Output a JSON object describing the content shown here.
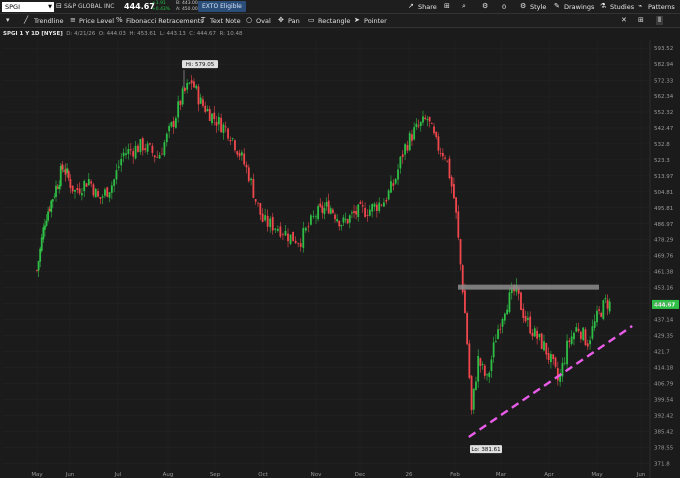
{
  "header": {
    "symbol": "SPGI",
    "company": "S&P GLOBAL INC",
    "last_price": "444.67",
    "change_line1": "+1.91",
    "change_line2": "+0.43%",
    "bid_line1": "B: 443.00",
    "bid_line2": "A: 450.00",
    "badge": "EXTO Eligible",
    "share_label": "Share",
    "count_label": "0",
    "style_label": "Style",
    "drawings_label": "Drawings",
    "studies_label": "Studies",
    "patterns_label": "Patterns"
  },
  "drawing_tools": {
    "trendline": "Trendline",
    "price_level": "Price Level",
    "fibonacci": "Fibonacci Retracements",
    "text_note": "Text Note",
    "oval": "Oval",
    "pan": "Pan",
    "rectangle": "Rectangle",
    "pointer": "Pointer"
  },
  "legend": {
    "title": "SPGI 1 Y 1D [NYSE]",
    "date": "D: 4/21/26",
    "open": "O: 444.03",
    "high": "H: 453.61",
    "low": "L: 443.13",
    "close": "C: 444.67",
    "volume": "R: 10.48"
  },
  "chart_data": {
    "type": "candlestick",
    "x_labels": [
      "May",
      "Jun",
      "Jul",
      "Aug",
      "Sep",
      "Oct",
      "Nov",
      "Dec",
      "26",
      "Feb",
      "Mar",
      "Apr",
      "May",
      "Jun"
    ],
    "y_ticks": [
      "593.52",
      "582.94",
      "572.33",
      "562.34",
      "552.32",
      "542.47",
      "532.8",
      "523.3",
      "513.97",
      "504.81",
      "495.81",
      "486.97",
      "478.29",
      "469.76",
      "461.38",
      "453.16",
      "445.0",
      "437.14",
      "429.35",
      "421.7",
      "414.18",
      "406.79",
      "399.54",
      "392.42",
      "385.42",
      "378.55",
      "371.8"
    ],
    "ylim": [
      369.0,
      599.0
    ],
    "y_scale": "log",
    "last_price": 444.67,
    "last_price_label": "444.67",
    "high_label": "Hi: 579.05",
    "low_label": "Lo: 381.61",
    "high_value": 579.05,
    "low_value": 381.61,
    "resistance_level": 453.16,
    "support_trendline": [
      {
        "month_index": 9.3,
        "price": 383
      },
      {
        "month_index": 12.8,
        "price": 434
      }
    ],
    "close_path": [
      {
        "m": 0.0,
        "v": 462
      },
      {
        "m": 0.25,
        "v": 490
      },
      {
        "m": 0.5,
        "v": 503
      },
      {
        "m": 0.8,
        "v": 520
      },
      {
        "m": 1.1,
        "v": 505
      },
      {
        "m": 1.4,
        "v": 512
      },
      {
        "m": 1.6,
        "v": 500
      },
      {
        "m": 1.9,
        "v": 510
      },
      {
        "m": 2.1,
        "v": 527
      },
      {
        "m": 2.5,
        "v": 532
      },
      {
        "m": 2.8,
        "v": 525
      },
      {
        "m": 3.1,
        "v": 545
      },
      {
        "m": 3.3,
        "v": 562
      },
      {
        "m": 3.5,
        "v": 572
      },
      {
        "m": 3.7,
        "v": 558
      },
      {
        "m": 4.0,
        "v": 548
      },
      {
        "m": 4.3,
        "v": 540
      },
      {
        "m": 4.5,
        "v": 528
      },
      {
        "m": 4.7,
        "v": 515
      },
      {
        "m": 4.85,
        "v": 500
      },
      {
        "m": 5.0,
        "v": 488
      },
      {
        "m": 5.3,
        "v": 485
      },
      {
        "m": 5.5,
        "v": 480
      },
      {
        "m": 5.7,
        "v": 478
      },
      {
        "m": 6.0,
        "v": 492
      },
      {
        "m": 6.3,
        "v": 497
      },
      {
        "m": 6.6,
        "v": 487
      },
      {
        "m": 6.9,
        "v": 493
      },
      {
        "m": 7.2,
        "v": 495
      },
      {
        "m": 7.5,
        "v": 500
      },
      {
        "m": 7.7,
        "v": 510
      },
      {
        "m": 7.9,
        "v": 530
      },
      {
        "m": 8.1,
        "v": 540
      },
      {
        "m": 8.4,
        "v": 548
      },
      {
        "m": 8.6,
        "v": 532
      },
      {
        "m": 8.8,
        "v": 526
      },
      {
        "m": 9.0,
        "v": 498
      },
      {
        "m": 9.1,
        "v": 470
      },
      {
        "m": 9.2,
        "v": 445
      },
      {
        "m": 9.3,
        "v": 415
      },
      {
        "m": 9.35,
        "v": 392
      },
      {
        "m": 9.5,
        "v": 418
      },
      {
        "m": 9.7,
        "v": 408
      },
      {
        "m": 9.9,
        "v": 430
      },
      {
        "m": 10.1,
        "v": 445
      },
      {
        "m": 10.3,
        "v": 452
      },
      {
        "m": 10.5,
        "v": 438
      },
      {
        "m": 10.7,
        "v": 430
      },
      {
        "m": 10.9,
        "v": 424
      },
      {
        "m": 11.1,
        "v": 414
      },
      {
        "m": 11.2,
        "v": 407
      },
      {
        "m": 11.4,
        "v": 426
      },
      {
        "m": 11.6,
        "v": 434
      },
      {
        "m": 11.8,
        "v": 426
      },
      {
        "m": 12.0,
        "v": 438
      },
      {
        "m": 12.2,
        "v": 446
      },
      {
        "m": 12.3,
        "v": 444.67
      }
    ]
  }
}
